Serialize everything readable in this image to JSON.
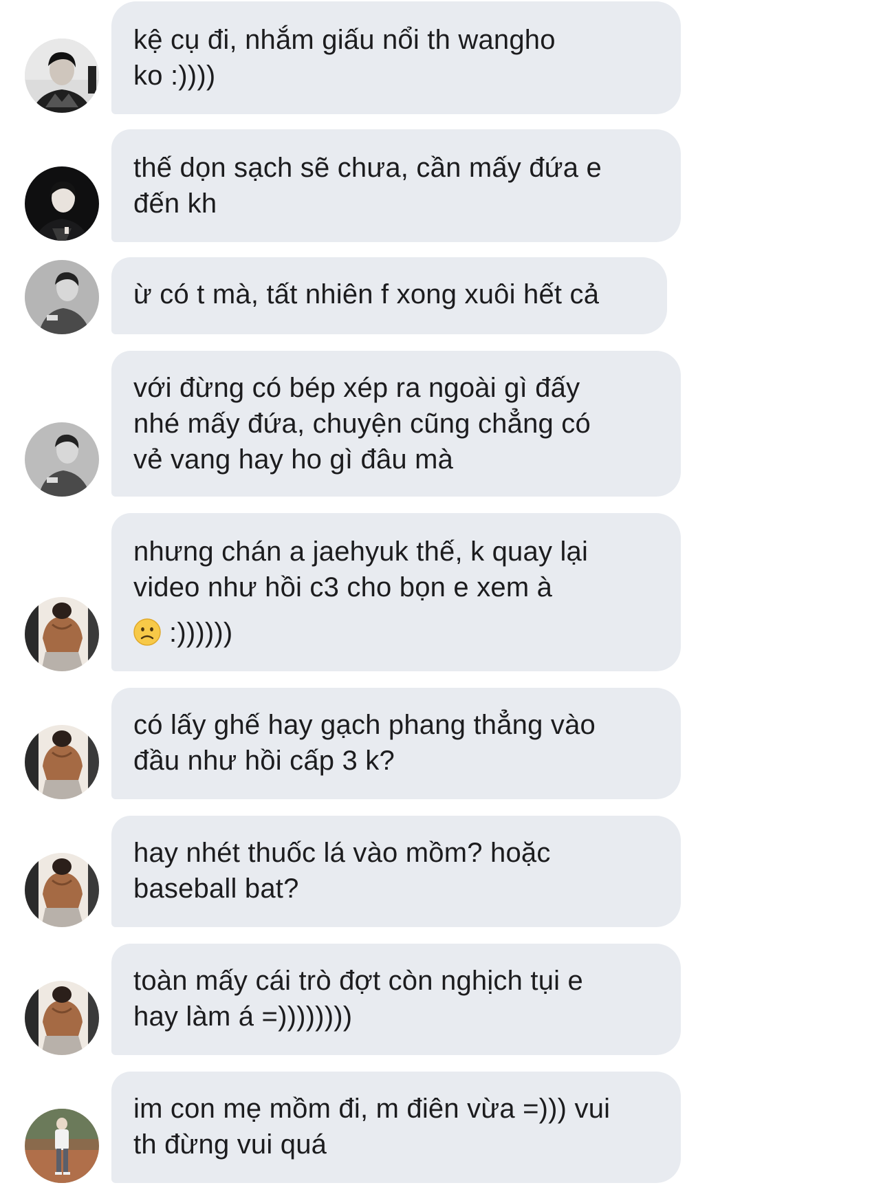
{
  "messages": [
    {
      "lines": [
        "kệ cụ đi, nhắm giấu nổi th wangho",
        "ko :))))"
      ]
    },
    {
      "lines": [
        "thế dọn sạch sẽ chưa, cần mấy đứa e",
        "đến kh"
      ]
    },
    {
      "lines": [
        "ừ có t mà, tất nhiên f xong xuôi hết cả"
      ]
    },
    {
      "lines": [
        "với đừng có bép xép ra ngoài gì đấy",
        "nhé mấy đứa, chuyện cũng chẳng có",
        "vẻ vang hay ho gì đâu mà"
      ]
    },
    {
      "lines": [
        "nhưng chán a jaehyuk thế, k quay lại",
        "video như hồi c3 cho bọn e xem à"
      ],
      "emoji_line": ":))))))",
      "emoji": "frowning-face"
    },
    {
      "lines": [
        "có lấy ghế hay gạch phang thẳng vào",
        "đầu như hồi cấp 3 k?"
      ]
    },
    {
      "lines": [
        "hay nhét thuốc lá vào mồm? hoặc",
        "baseball bat?"
      ]
    },
    {
      "lines": [
        "toàn mấy cái trò đợt còn nghịch tụi e",
        "hay làm á =))))))))"
      ]
    },
    {
      "lines": [
        "im con mẹ mồm đi, m điên vừa =))) vui",
        "th đừng vui quá"
      ]
    }
  ],
  "avatars": [
    {
      "icon": "avatar-person-1"
    },
    {
      "icon": "avatar-person-2"
    },
    {
      "icon": "avatar-person-3"
    },
    {
      "icon": "avatar-person-3"
    },
    {
      "icon": "avatar-person-4"
    },
    {
      "icon": "avatar-person-4"
    },
    {
      "icon": "avatar-person-4"
    },
    {
      "icon": "avatar-person-4"
    },
    {
      "icon": "avatar-person-5"
    }
  ],
  "colors": {
    "bubble": "#e8ebf0",
    "text": "#1c1c1e",
    "background": "#ffffff"
  }
}
